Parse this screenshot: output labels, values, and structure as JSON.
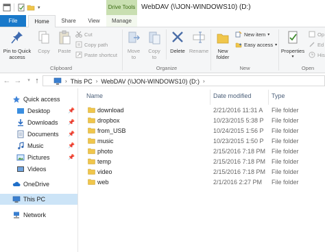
{
  "titlebar": {
    "context_tab": "Drive Tools",
    "title": "WebDAV (\\\\JON-WINDOWS10) (D:)"
  },
  "tabs": {
    "file": "File",
    "home": "Home",
    "share": "Share",
    "view": "View",
    "manage": "Manage"
  },
  "ribbon": {
    "clipboard": {
      "pin": [
        "Pin to Quick",
        "access"
      ],
      "copy": "Copy",
      "paste": "Paste",
      "cut": "Cut",
      "copy_path": "Copy path",
      "paste_shortcut": "Paste shortcut",
      "group_label": "Clipboard"
    },
    "organize": {
      "move_to": [
        "Move",
        "to"
      ],
      "copy_to": [
        "Copy",
        "to"
      ],
      "delete": "Delete",
      "rename": "Rename",
      "group_label": "Organize"
    },
    "new": {
      "new_folder": [
        "New",
        "folder"
      ],
      "new_item": "New item",
      "easy_access": "Easy access",
      "group_label": "New"
    },
    "open": {
      "properties": "Properties",
      "open": "Op",
      "edit": "Ed",
      "history": "Hist",
      "group_label": "Open"
    }
  },
  "address": {
    "crumbs": [
      "This PC",
      "WebDAV (\\\\JON-WINDOWS10) (D:)"
    ]
  },
  "nav": {
    "quick_access": "Quick access",
    "desktop": "Desktop",
    "downloads": "Downloads",
    "documents": "Documents",
    "music": "Music",
    "pictures": "Pictures",
    "videos": "Videos",
    "onedrive": "OneDrive",
    "this_pc": "This PC",
    "network": "Network"
  },
  "columns": {
    "name": "Name",
    "date": "Date modified",
    "type": "Type"
  },
  "files": [
    {
      "name": "download",
      "date": "2/21/2016 11:31 A",
      "type": "File folder"
    },
    {
      "name": "dropbox",
      "date": "10/23/2015 5:38 P",
      "type": "File folder"
    },
    {
      "name": "from_USB",
      "date": "10/24/2015 1:56 P",
      "type": "File folder"
    },
    {
      "name": "music",
      "date": "10/23/2015 1:50 P",
      "type": "File folder"
    },
    {
      "name": "photo",
      "date": "2/15/2016 7:18 PM",
      "type": "File folder"
    },
    {
      "name": "temp",
      "date": "2/15/2016 7:18 PM",
      "type": "File folder"
    },
    {
      "name": "video",
      "date": "2/15/2016 7:18 PM",
      "type": "File folder"
    },
    {
      "name": "web",
      "date": "2/1/2016 2:27 PM",
      "type": "File folder"
    }
  ],
  "colors": {
    "file_tab": "#1979ca",
    "context_tab": "#c9dfb1",
    "selection": "#cce4f7",
    "folder": "#f0c64b"
  }
}
